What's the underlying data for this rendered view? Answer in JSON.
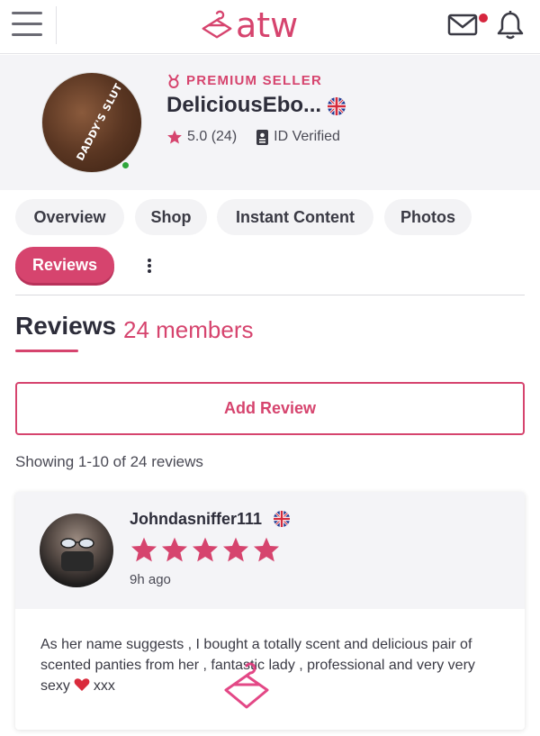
{
  "header": {
    "logo_text": "atw",
    "brand_color": "#d6446e",
    "icons": [
      "menu-icon",
      "hanger-logo-icon",
      "mail-icon",
      "bell-icon"
    ]
  },
  "profile": {
    "badge": "PREMIUM SELLER",
    "name": "DeliciousEbo...",
    "avatar_text": "DADDY'S SLUT",
    "rating": "5.0 (24)",
    "verified": "ID Verified",
    "online": true
  },
  "tabs": [
    {
      "label": "Overview",
      "active": false
    },
    {
      "label": "Shop",
      "active": false
    },
    {
      "label": "Instant Content",
      "active": false
    },
    {
      "label": "Photos",
      "active": false
    },
    {
      "label": "Reviews",
      "active": true
    }
  ],
  "reviews": {
    "heading": "Reviews",
    "count_label": "24 members",
    "add_button": "Add Review",
    "showing": "Showing 1-10 of 24 reviews",
    "items": [
      {
        "author": "Johndasniffer111",
        "stars": 5,
        "time": "9h ago",
        "text_before": "As her name suggests , I bought a totally scent and delicious pair of scented panties from her , fantastic lady , professional and very very sexy",
        "text_after": "xxx"
      }
    ]
  }
}
